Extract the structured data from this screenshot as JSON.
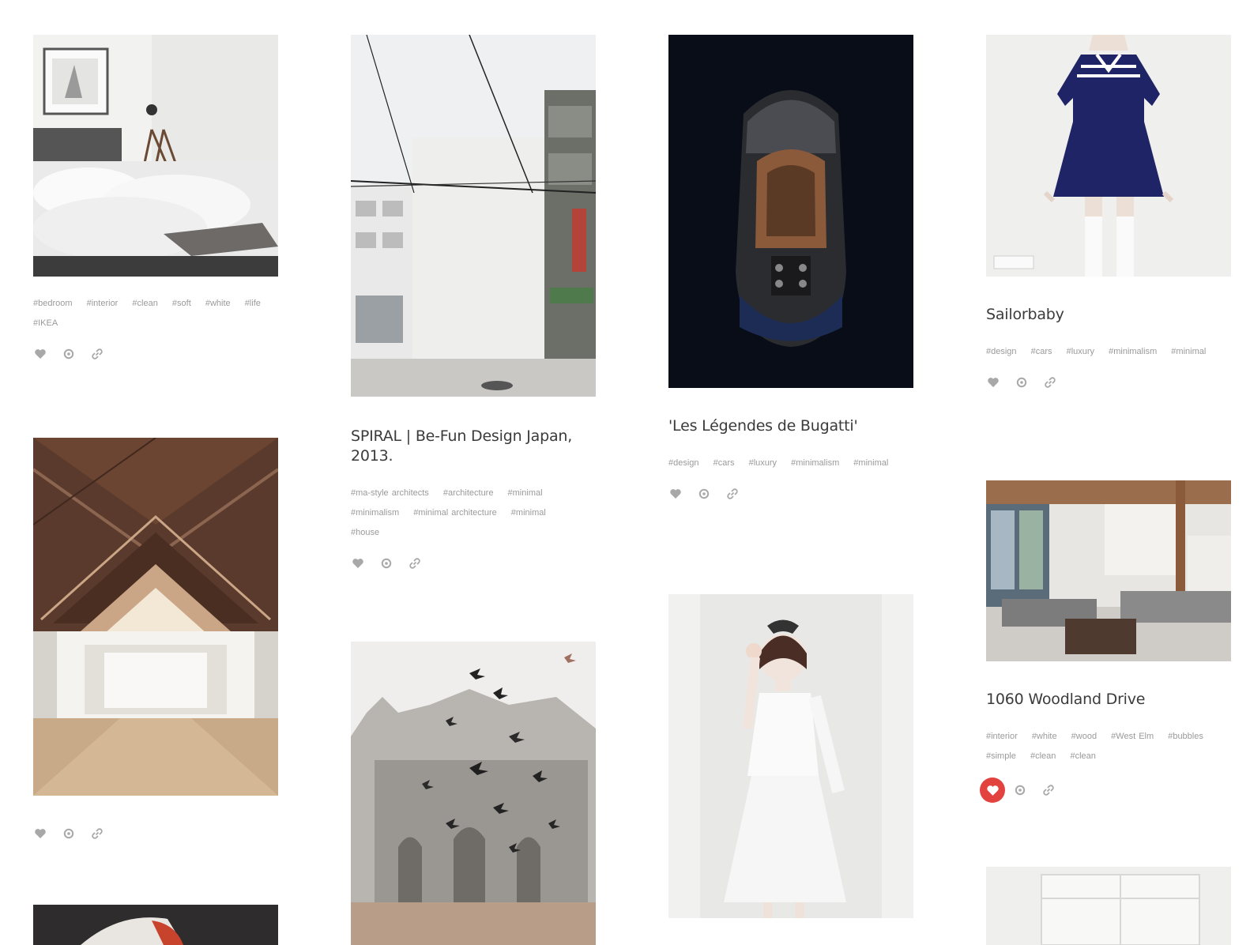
{
  "colors": {
    "accent_like": "#e2433e",
    "title": "#3b3b3b",
    "tag": "#9a9a9a",
    "icon": "#a8a8a8"
  },
  "posts": [
    {
      "id": "bedroom",
      "title": "",
      "tags": [
        "#bedroom",
        "#interior",
        "#clean",
        "#soft",
        "#white",
        "#life",
        "#IKEA"
      ],
      "liked": false
    },
    {
      "id": "house-roof",
      "title": "",
      "tags": [],
      "liked": false
    },
    {
      "id": "spiral",
      "title": "SPIRAL | Be-Fun Design Japan, 2013.",
      "tags": [
        "#ma-style architects",
        "#architecture",
        "#minimal",
        "#minimalism",
        "#minimal architecture",
        "#minimal",
        "#house"
      ],
      "liked": false
    },
    {
      "id": "church-birds",
      "title": "",
      "tags": [],
      "liked": false
    },
    {
      "id": "bugatti",
      "title": "'Les Légendes de Bugatti'",
      "tags": [
        "#design",
        "#cars",
        "#luxury",
        "#minimalism",
        "#minimal"
      ],
      "liked": false
    },
    {
      "id": "girl-white-dress",
      "title": "",
      "tags": [],
      "liked": false
    },
    {
      "id": "sailorbaby",
      "title": "Sailorbaby",
      "tags": [
        "#design",
        "#cars",
        "#luxury",
        "#minimalism",
        "#minimal"
      ],
      "liked": false
    },
    {
      "id": "woodland",
      "title": "1060 Woodland Drive",
      "tags": [
        "#interior",
        "#white",
        "#wood",
        "#West Elm",
        "#bubbles",
        "#simple",
        "#clean",
        "#clean"
      ],
      "liked": true
    },
    {
      "id": "white-room",
      "title": "",
      "tags": [],
      "liked": false
    },
    {
      "id": "object-dark",
      "title": "",
      "tags": [],
      "liked": false
    }
  ]
}
